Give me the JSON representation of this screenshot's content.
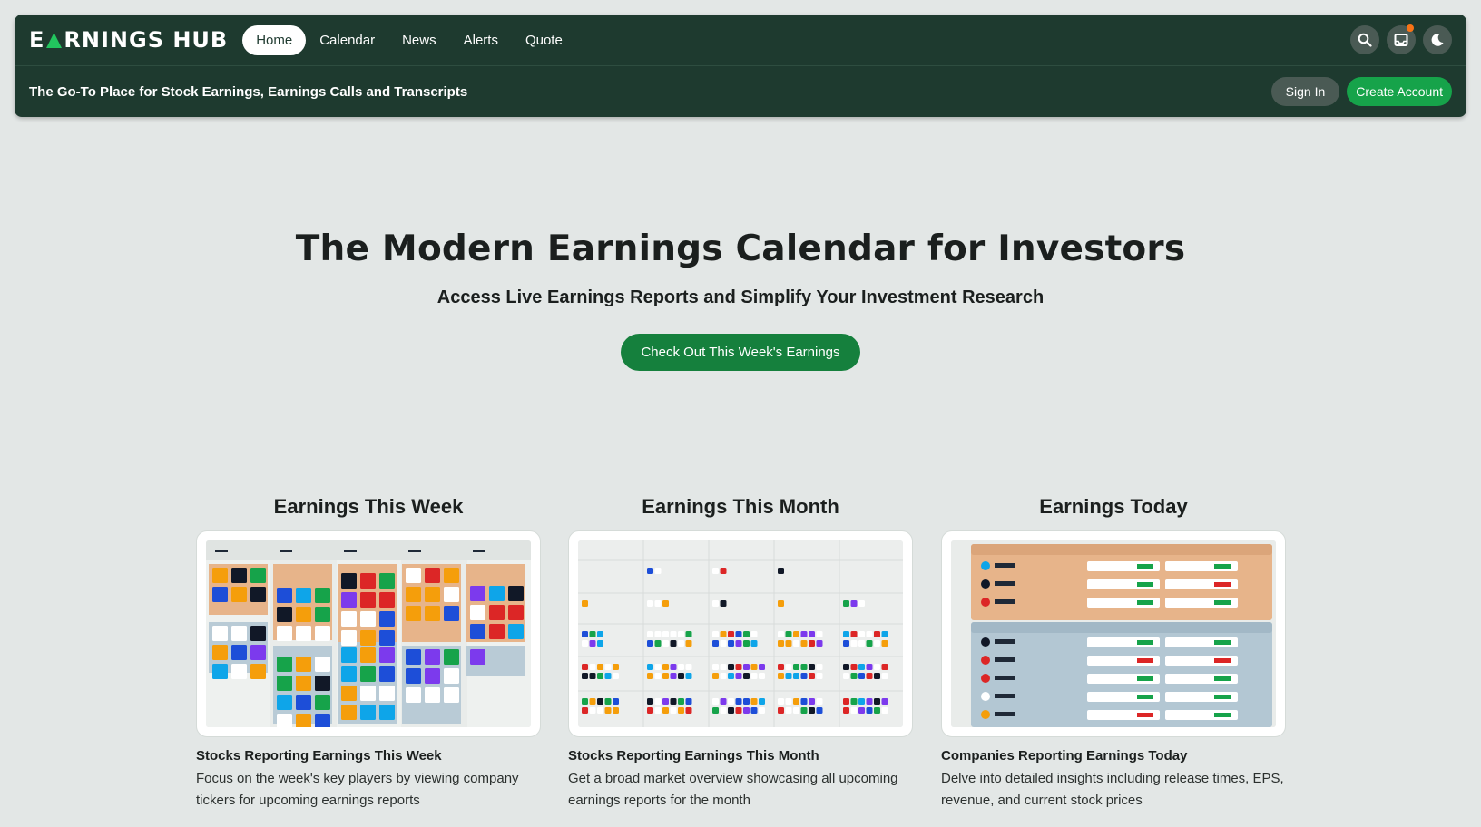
{
  "brand": {
    "name": "EARNINGS HUB",
    "name_part1": "E",
    "name_part2": "RNINGS HUB"
  },
  "nav": {
    "items": [
      "Home",
      "Calendar",
      "News",
      "Alerts",
      "Quote"
    ],
    "active": "Home"
  },
  "header": {
    "tagline": "The Go-To Place for Stock Earnings, Earnings Calls and Transcripts",
    "sign_in": "Sign In",
    "create_account": "Create Account",
    "icons": [
      "search-icon",
      "inbox-icon",
      "moon-icon"
    ]
  },
  "hero": {
    "title": "The Modern Earnings Calendar for Investors",
    "subtitle": "Access Live Earnings Reports and Simplify Your Investment Research",
    "cta": "Check Out This Week's Earnings"
  },
  "cards": [
    {
      "title": "Earnings This Week",
      "heading": "Stocks Reporting Earnings This Week",
      "description": "Focus on the week's key players by viewing company tickers for upcoming earnings reports"
    },
    {
      "title": "Earnings This Month",
      "heading": "Stocks Reporting Earnings This Month",
      "description": "Get a broad market overview showcasing all upcoming earnings reports for the month"
    },
    {
      "title": "Earnings Today",
      "heading": "Companies Reporting Earnings Today",
      "description": "Delve into detailed insights including release times, EPS, revenue, and current stock prices"
    }
  ],
  "colors": {
    "header_bg": "#1e3a2f",
    "accent_green": "#16a34a",
    "cta_green": "#15803d",
    "page_bg": "#e3e7e6",
    "notification": "#f97316"
  }
}
